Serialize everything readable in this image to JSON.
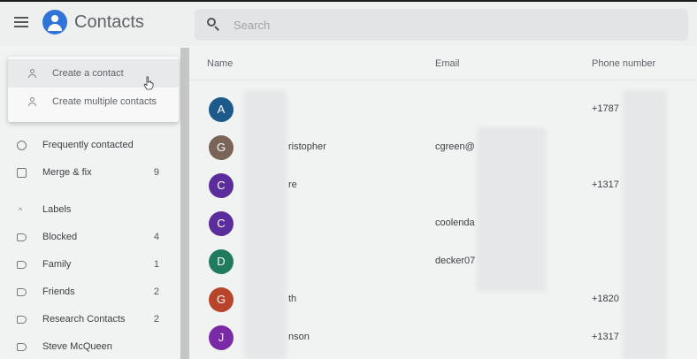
{
  "header": {
    "app_title": "Contacts",
    "search_placeholder": "Search",
    "menu_icon": "hamburger-menu-icon",
    "logo_icon": "contacts-logo-icon",
    "logo_color": "#2f74d8"
  },
  "create_menu": {
    "items": [
      {
        "label": "Create a contact",
        "icon": "person-add-icon"
      },
      {
        "label": "Create multiple contacts",
        "icon": "people-add-icon"
      }
    ]
  },
  "sidebar": {
    "items": [
      {
        "label": "Frequently contacted",
        "icon": "history-icon",
        "count": ""
      },
      {
        "label": "Merge & fix",
        "icon": "merge-icon",
        "count": "9"
      }
    ],
    "labels_header": "Labels",
    "labels": [
      {
        "label": "Blocked",
        "count": "4"
      },
      {
        "label": "Family",
        "count": "1"
      },
      {
        "label": "Friends",
        "count": "2"
      },
      {
        "label": "Research Contacts",
        "count": "2"
      },
      {
        "label": "Steve McQueen",
        "count": ""
      }
    ]
  },
  "table": {
    "columns": {
      "name": "Name",
      "email": "Email",
      "phone": "Phone number"
    },
    "rows": [
      {
        "initial": "A",
        "color": "#1d5a8c",
        "name": "",
        "email": "",
        "phone": "+1787"
      },
      {
        "initial": "G",
        "color": "#7a6357",
        "name": "ristopher",
        "email": "cgreen@",
        "phone": ""
      },
      {
        "initial": "C",
        "color": "#5b2d9c",
        "name": "re",
        "email": "",
        "phone": "+1317"
      },
      {
        "initial": "C",
        "color": "#5b2d9c",
        "name": "",
        "email": "coolenda",
        "phone": ""
      },
      {
        "initial": "D",
        "color": "#1f7a5e",
        "name": "",
        "email": "decker07",
        "phone": ""
      },
      {
        "initial": "G",
        "color": "#b8442b",
        "name": "th",
        "email": "",
        "phone": "+1820"
      },
      {
        "initial": "J",
        "color": "#7b2aa5",
        "name": "nson",
        "email": "",
        "phone": "+1317"
      }
    ]
  }
}
